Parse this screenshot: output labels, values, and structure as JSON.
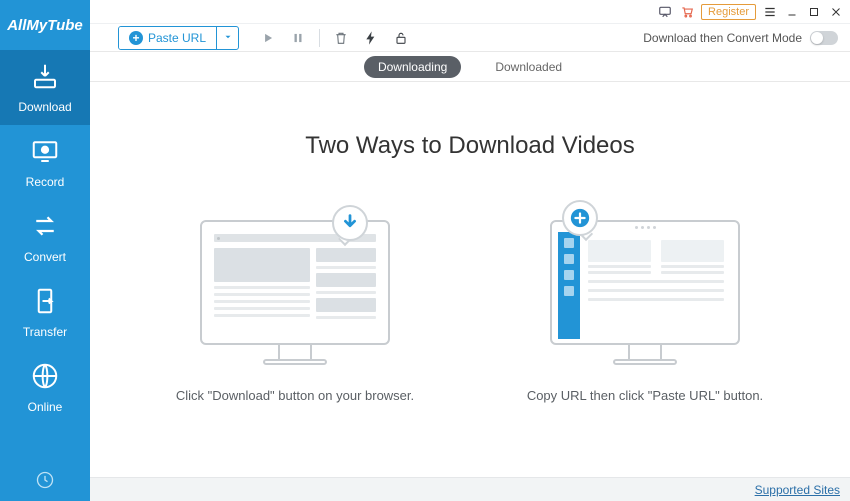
{
  "app_name": "AllMyTube",
  "sidebar": {
    "items": [
      {
        "label": "Download"
      },
      {
        "label": "Record"
      },
      {
        "label": "Convert"
      },
      {
        "label": "Transfer"
      },
      {
        "label": "Online"
      }
    ]
  },
  "titlebar": {
    "register_label": "Register"
  },
  "toolbar": {
    "paste_url_label": "Paste URL",
    "convert_mode_label": "Download then Convert Mode"
  },
  "tabs": {
    "downloading": "Downloading",
    "downloaded": "Downloaded"
  },
  "content": {
    "headline": "Two Ways to Download Videos",
    "method1_caption": "Click \"Download\" button on your browser.",
    "method2_caption": "Copy URL then click \"Paste URL\" button."
  },
  "footer": {
    "supported_sites": "Supported Sites"
  },
  "icons": {
    "download": "download-icon",
    "record": "record-icon",
    "convert": "convert-icon",
    "transfer": "transfer-icon",
    "online": "online-icon",
    "clock": "clock-icon",
    "play": "play-icon",
    "pause": "pause-icon",
    "trash": "trash-icon",
    "bolt": "bolt-icon",
    "unlock": "unlock-icon",
    "feedback": "feedback-icon",
    "cart": "cart-icon",
    "menu": "menu-icon",
    "minimize": "minimize-icon",
    "maximize": "maximize-icon",
    "close": "close-icon",
    "plus": "plus-icon",
    "chevron_down": "chevron-down-icon",
    "arrow_down_circle": "arrow-down-circle-icon"
  },
  "colors": {
    "primary": "#2294d6",
    "primary_dark": "#1678b4",
    "accent_register": "#e59b3a",
    "pill_active": "#5a5f66"
  }
}
